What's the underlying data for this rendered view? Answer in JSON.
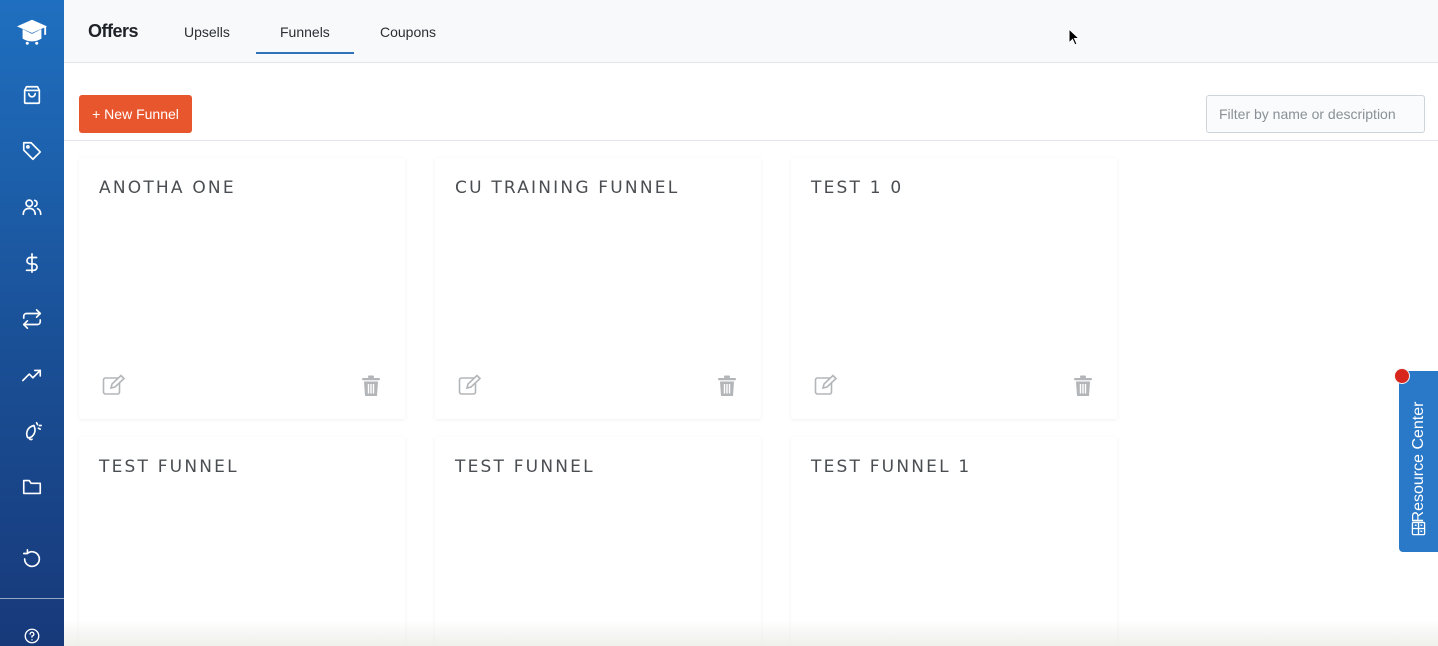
{
  "nav": {
    "title": "Offers",
    "tabs": [
      {
        "label": "Upsells"
      },
      {
        "label": "Funnels",
        "active": true
      },
      {
        "label": "Coupons"
      }
    ]
  },
  "sidebar": {
    "items": [
      {
        "icon": "shopping-bag-icon"
      },
      {
        "icon": "tag-icon"
      },
      {
        "icon": "users-icon"
      },
      {
        "icon": "dollar-icon"
      },
      {
        "icon": "repeat-icon"
      },
      {
        "icon": "trending-up-icon"
      },
      {
        "icon": "bell-icon"
      },
      {
        "icon": "folder-icon"
      },
      {
        "icon": "history-icon"
      },
      {
        "icon": "help-circle-icon"
      }
    ]
  },
  "toolbar": {
    "new_button_label": "+ New Funnel",
    "filter_placeholder": "Filter by name or description"
  },
  "funnels": [
    {
      "name": "ANOTHA ONE"
    },
    {
      "name": "CU TRAINING FUNNEL"
    },
    {
      "name": "TEST 1 0"
    },
    {
      "name": "TEST FUNNEL"
    },
    {
      "name": "TEST FUNNEL"
    },
    {
      "name": "TEST FUNNEL 1"
    }
  ],
  "resource_center": {
    "label": "Resource Center"
  },
  "colors": {
    "sidebar_top": "#1f6fc0",
    "sidebar_bottom": "#17397a",
    "primary_button": "#e8562e",
    "tab_underline": "#2f72b8",
    "resource_center": "#2a78c8",
    "notification_dot": "#d9261c"
  }
}
